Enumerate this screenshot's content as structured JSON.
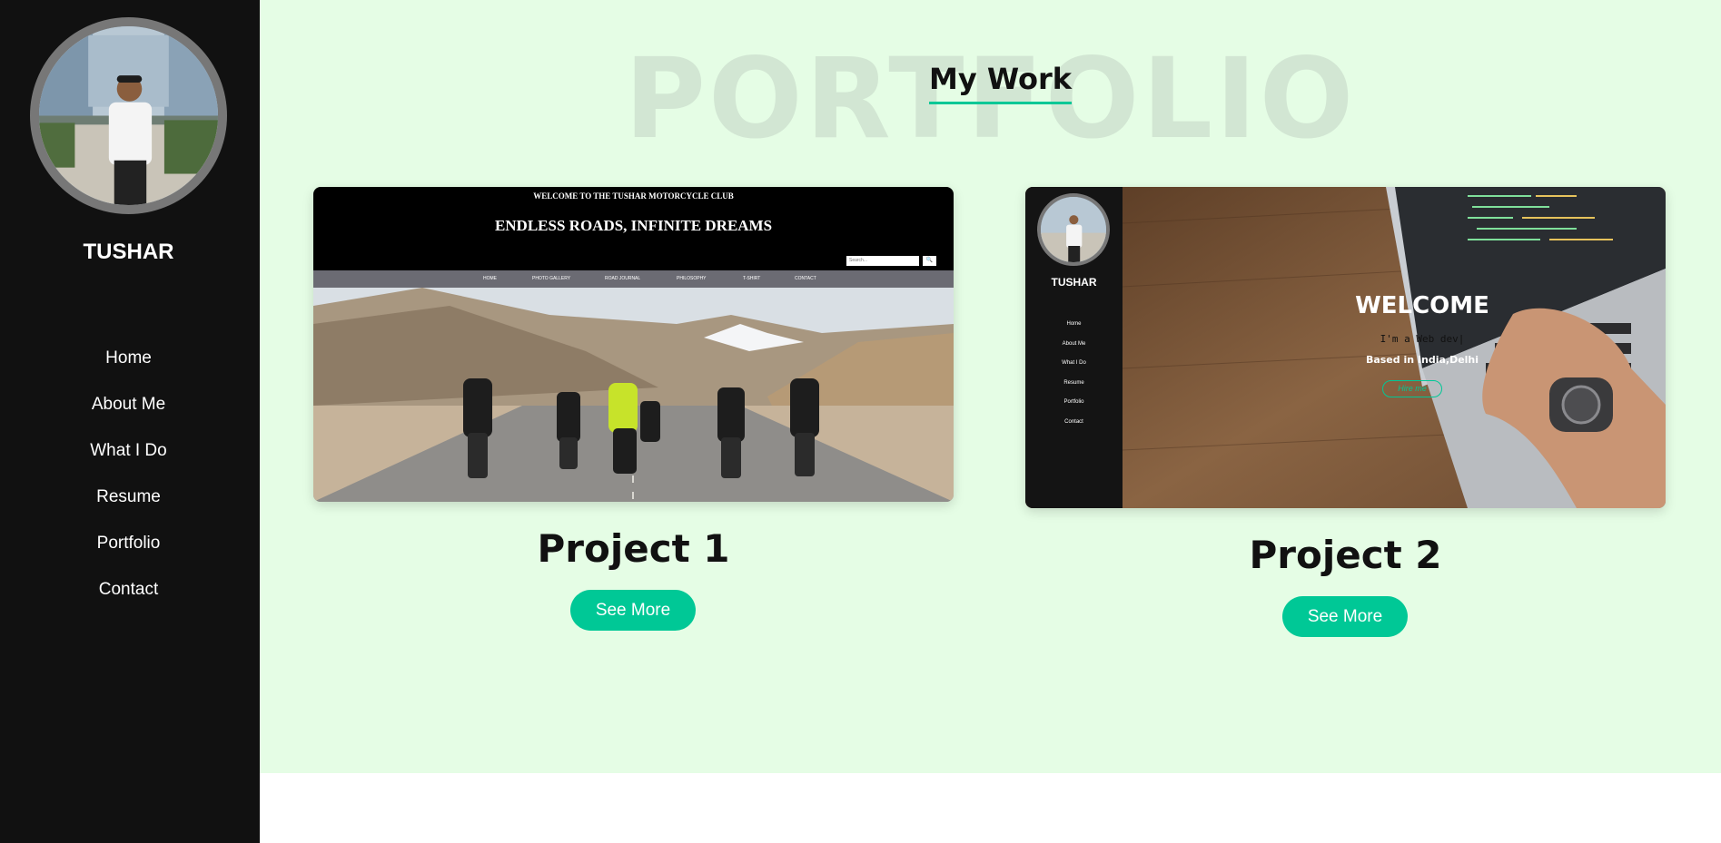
{
  "sidebar": {
    "name": "TUSHAR",
    "nav": [
      "Home",
      "About Me",
      "What I Do",
      "Resume",
      "Portfolio",
      "Contact"
    ]
  },
  "portfolio": {
    "background_word": "PORTFOLIO",
    "title": "My Work",
    "projects": [
      {
        "title": "Project 1",
        "button": "See More",
        "preview": {
          "club_title": "WELCOME TO THE TUSHAR MOTORCYCLE CLUB",
          "tagline": "ENDLESS ROADS, INFINITE DREAMS",
          "search_placeholder": "Search...",
          "nav": [
            "HOME",
            "PHOTO GALLERY",
            "ROAD JOURNAL",
            "PHILOSOPHY",
            "T-SHIRT",
            "CONTACT"
          ]
        }
      },
      {
        "title": "Project 2",
        "button": "See More",
        "preview": {
          "name": "TUSHAR",
          "nav": [
            "Home",
            "About Me",
            "What I Do",
            "Resume",
            "Portfolio",
            "Contact"
          ],
          "welcome": "WELCOME",
          "subtitle": "I'm a Web dev|",
          "location": "Based in India,Delhi",
          "hire": "Hire me"
        }
      }
    ]
  },
  "colors": {
    "sidebar_bg": "#111111",
    "main_bg": "#e5fde5",
    "accent": "#00c896",
    "bg_word": "#d2e6d3"
  }
}
